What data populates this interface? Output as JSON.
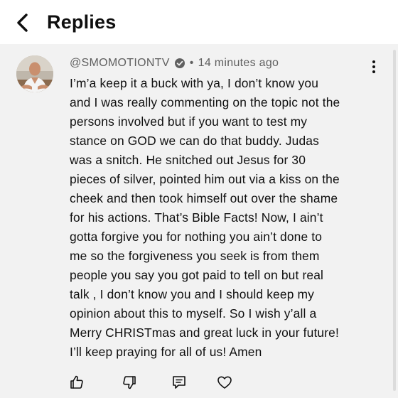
{
  "header": {
    "title": "Replies",
    "back_icon": "chevron-left-icon"
  },
  "comment": {
    "handle": "@SMOMOTIONTV",
    "verified_icon": "verified-badge-icon",
    "separator": "•",
    "timestamp": "14 minutes ago",
    "lines": [
      "I’m’a keep it a buck with ya,  I don’t know you",
      "and I was really commenting on the topic not the",
      "persons involved but if you want to test my",
      "stance on GOD we can do that buddy. Judas",
      "was a snitch. He snitched out Jesus for 30",
      "pieces of silver, pointed him out via a kiss on the",
      "cheek and then took himself out over the shame",
      "for his actions. That’s Bible Facts! Now, I ain’t",
      "gotta forgive you for nothing you ain’t done to",
      "me so the forgiveness you seek is from them",
      "people you say you got paid to tell on but real",
      "talk , I don’t know you and I should keep my",
      "opinion about this to myself. So I wish y’all a",
      "Merry CHRISTmas and great luck in your future!",
      "I’ll keep praying for all of us! Amen"
    ],
    "actions": [
      "thumbs-up-icon",
      "thumbs-down-icon",
      "reply-icon",
      "heart-icon"
    ]
  },
  "colors": {
    "comment_background": "#f2f2f2",
    "header_background": "#ffffff",
    "text": "#0f0f0f",
    "meta_text": "#606060"
  }
}
